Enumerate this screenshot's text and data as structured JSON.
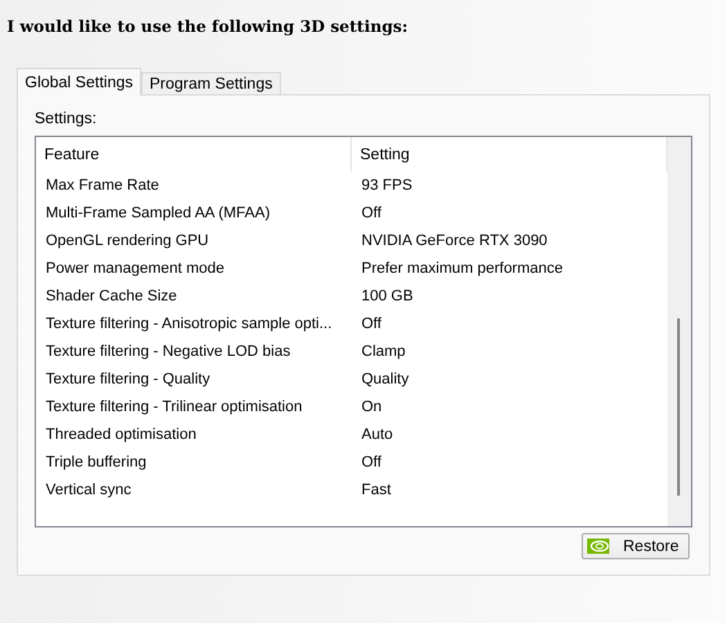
{
  "heading": "I would like to use the following 3D settings:",
  "tabs": [
    {
      "label": "Global Settings",
      "selected": true
    },
    {
      "label": "Program Settings",
      "selected": false
    }
  ],
  "settings_label": "Settings:",
  "table": {
    "columns": [
      "Feature",
      "Setting"
    ],
    "rows": [
      [
        "Max Frame Rate",
        "93 FPS"
      ],
      [
        "Multi-Frame Sampled AA (MFAA)",
        "Off"
      ],
      [
        "OpenGL rendering GPU",
        "NVIDIA GeForce RTX 3090"
      ],
      [
        "Power management mode",
        "Prefer maximum performance"
      ],
      [
        "Shader Cache Size",
        "100 GB"
      ],
      [
        "Texture filtering - Anisotropic sample opti...",
        "Off"
      ],
      [
        "Texture filtering - Negative LOD bias",
        "Clamp"
      ],
      [
        "Texture filtering - Quality",
        "Quality"
      ],
      [
        "Texture filtering - Trilinear optimisation",
        "On"
      ],
      [
        "Threaded optimisation",
        "Auto"
      ],
      [
        "Triple buffering",
        "Off"
      ],
      [
        "Vertical sync",
        "Fast"
      ]
    ]
  },
  "restore_button": "Restore"
}
